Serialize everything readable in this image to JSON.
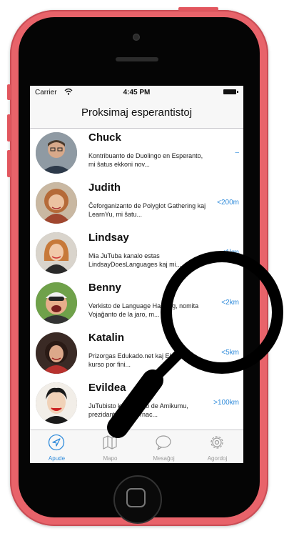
{
  "status_bar": {
    "carrier": "Carrier",
    "time": "4:45 PM"
  },
  "nav": {
    "title": "Proksimaj esperantistoj"
  },
  "people": [
    {
      "name": "Chuck",
      "description": "Kontribuanto de Duolingo en Esperanto, mi ŝatus ekkoni nov...",
      "distance": "–"
    },
    {
      "name": "Judith",
      "description": "Ĉeforganizanto de Polyglot Gathering kaj LearnYu, mi ŝatu...",
      "distance": "<200m"
    },
    {
      "name": "Lindsay",
      "description": "Mia JuTuba kanalo estas LindsayDoesLanguages kaj mi...",
      "distance": "<1km"
    },
    {
      "name": "Benny",
      "description": "Verkisto de Language Hacking, nomita Vojaĝanto de la jaro, m...",
      "distance": "<2km"
    },
    {
      "name": "Katalin",
      "description": "Prizorgas Edukado.net kaj Ekparolu, kurso por fini...",
      "distance": "<5km"
    },
    {
      "name": "Evildea",
      "description": "JuTubisto kaj kreanto de Amikumu, prezidanto de Internac...",
      "distance": ">100km"
    }
  ],
  "tabs": [
    {
      "label": "Apude",
      "icon": "compass-icon"
    },
    {
      "label": "Mapo",
      "icon": "map-icon"
    },
    {
      "label": "Mesaĝoj",
      "icon": "speech-bubble-icon"
    },
    {
      "label": "Agordoj",
      "icon": "gear-icon"
    }
  ],
  "colors": {
    "phone_body": "#e8636a",
    "accent": "#2f8bdb",
    "tab_inactive": "#9a9a9a"
  }
}
